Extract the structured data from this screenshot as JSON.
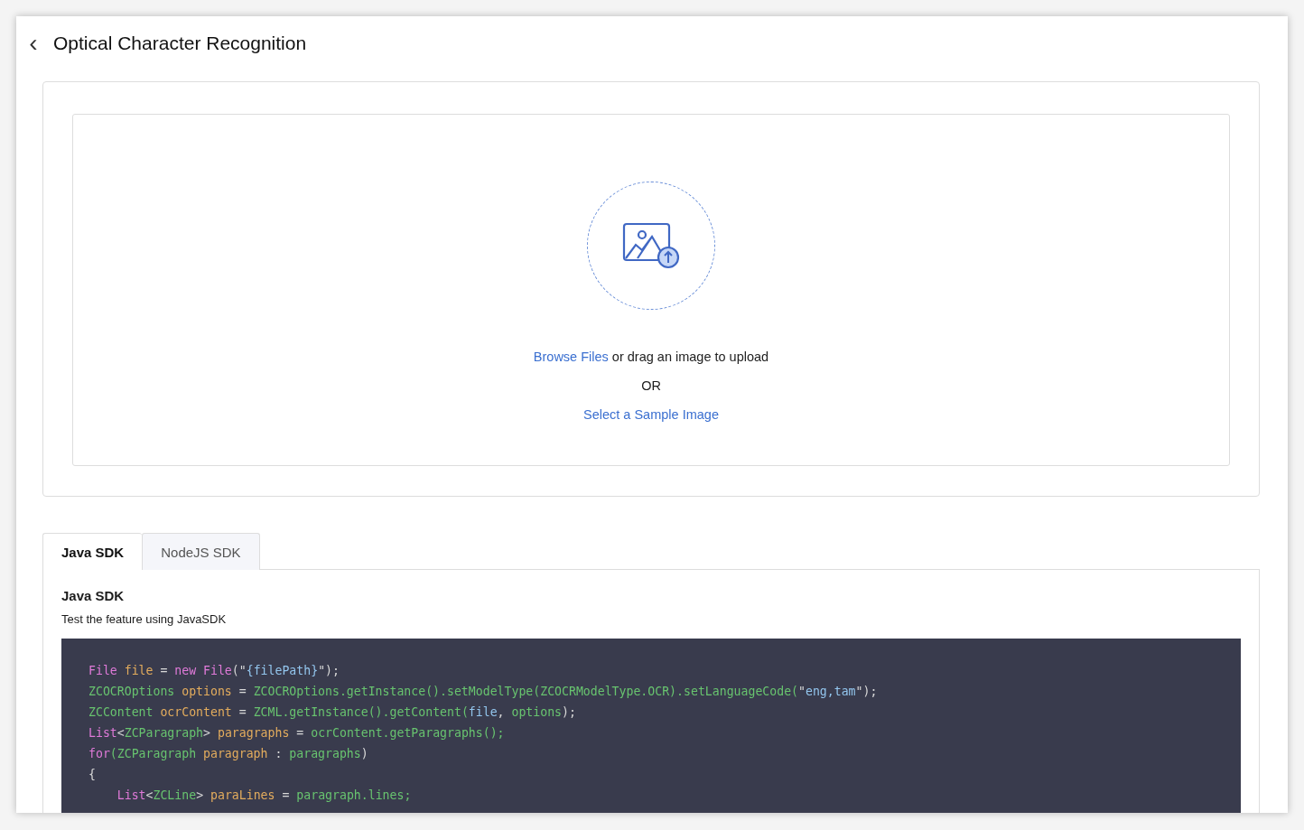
{
  "header": {
    "back_icon": "‹",
    "title": "Optical Character Recognition"
  },
  "upload": {
    "browse_link": "Browse Files",
    "prompt": "or drag an image to upload",
    "separator": "OR",
    "sample_link": "Select a Sample Image"
  },
  "tabs": [
    {
      "label": "Java SDK",
      "selected": true
    },
    {
      "label": "NodeJS SDK",
      "selected": false
    }
  ],
  "panel": {
    "heading": "Java SDK",
    "description": "Test the feature using JavaSDK",
    "code_lines": [
      [
        {
          "text": "File ",
          "kind": "keyword"
        },
        {
          "text": "file",
          "kind": "variable"
        },
        {
          "text": " = ",
          "kind": "plain"
        },
        {
          "text": "new File",
          "kind": "keyword"
        },
        {
          "text": "(\"",
          "kind": "plain"
        },
        {
          "text": "{filePath}",
          "kind": "string"
        },
        {
          "text": "\");",
          "kind": "plain"
        }
      ],
      [
        {
          "text": "ZCOCROptions ",
          "kind": "type"
        },
        {
          "text": "options",
          "kind": "variable"
        },
        {
          "text": " = ",
          "kind": "plain"
        },
        {
          "text": "ZCOCROptions.getInstance().setModelType(ZCOCRModelType.OCR).setLanguageCode(",
          "kind": "type"
        },
        {
          "text": "\"",
          "kind": "plain"
        },
        {
          "text": "eng,tam",
          "kind": "string"
        },
        {
          "text": "\");",
          "kind": "plain"
        }
      ],
      [
        {
          "text": "ZCContent ",
          "kind": "type"
        },
        {
          "text": "ocrContent",
          "kind": "variable"
        },
        {
          "text": " = ",
          "kind": "plain"
        },
        {
          "text": "ZCML.getInstance().getContent(",
          "kind": "type"
        },
        {
          "text": "file",
          "kind": "string"
        },
        {
          "text": ", ",
          "kind": "plain"
        },
        {
          "text": "options",
          "kind": "type"
        },
        {
          "text": ");",
          "kind": "plain"
        }
      ],
      [
        {
          "text": "List",
          "kind": "keyword"
        },
        {
          "text": "<",
          "kind": "plain"
        },
        {
          "text": "ZCParagraph",
          "kind": "type"
        },
        {
          "text": "> ",
          "kind": "plain"
        },
        {
          "text": "paragraphs",
          "kind": "variable"
        },
        {
          "text": " = ",
          "kind": "plain"
        },
        {
          "text": "ocrContent.getParagraphs();",
          "kind": "type"
        }
      ],
      [
        {
          "text": "for",
          "kind": "keyword"
        },
        {
          "text": "(ZCParagraph ",
          "kind": "type"
        },
        {
          "text": "paragraph",
          "kind": "variable"
        },
        {
          "text": " : ",
          "kind": "plain"
        },
        {
          "text": "paragraphs",
          "kind": "type"
        },
        {
          "text": ")",
          "kind": "plain"
        }
      ],
      [
        {
          "text": "{",
          "kind": "plain"
        }
      ],
      [
        {
          "text": "    List",
          "kind": "keyword"
        },
        {
          "text": "<",
          "kind": "plain"
        },
        {
          "text": "ZCLine",
          "kind": "type"
        },
        {
          "text": "> ",
          "kind": "plain"
        },
        {
          "text": "paraLines",
          "kind": "variable"
        },
        {
          "text": " = ",
          "kind": "plain"
        },
        {
          "text": "paragraph.lines;",
          "kind": "type"
        }
      ]
    ]
  }
}
